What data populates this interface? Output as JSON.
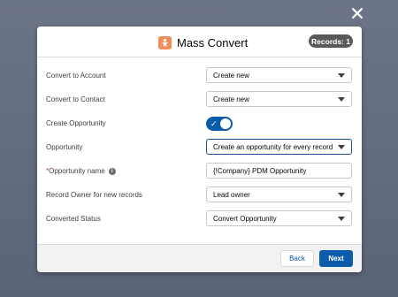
{
  "dialog": {
    "title": "Mass Convert",
    "icon": "convert-icon",
    "records_badge": "Records: 1",
    "close_icon": "close-icon"
  },
  "form": {
    "rows": [
      {
        "label": "Convert to Account",
        "type": "select",
        "value": "Create new"
      },
      {
        "label": "Convert to Contact",
        "type": "select",
        "value": "Create new"
      },
      {
        "label": "Create Opportunity",
        "type": "toggle",
        "value": "on"
      },
      {
        "label": "Opportunity",
        "type": "select",
        "value": "Create an opportunity for every record"
      },
      {
        "label": "Opportunity name",
        "type": "input",
        "required": "*",
        "value": "{!Company} PDM Opportunity",
        "info_icon": "info-icon"
      },
      {
        "label": "Record Owner for new records",
        "type": "select",
        "value": "Lead owner"
      },
      {
        "label": "Converted Status",
        "type": "select",
        "value": "Convert Opportunity"
      }
    ]
  },
  "footer": {
    "back_label": "Back",
    "next_label": "Next"
  },
  "colors": {
    "brand": "#0b5cab",
    "icon_orange": "#f08e5b",
    "badge": "#58595b"
  }
}
